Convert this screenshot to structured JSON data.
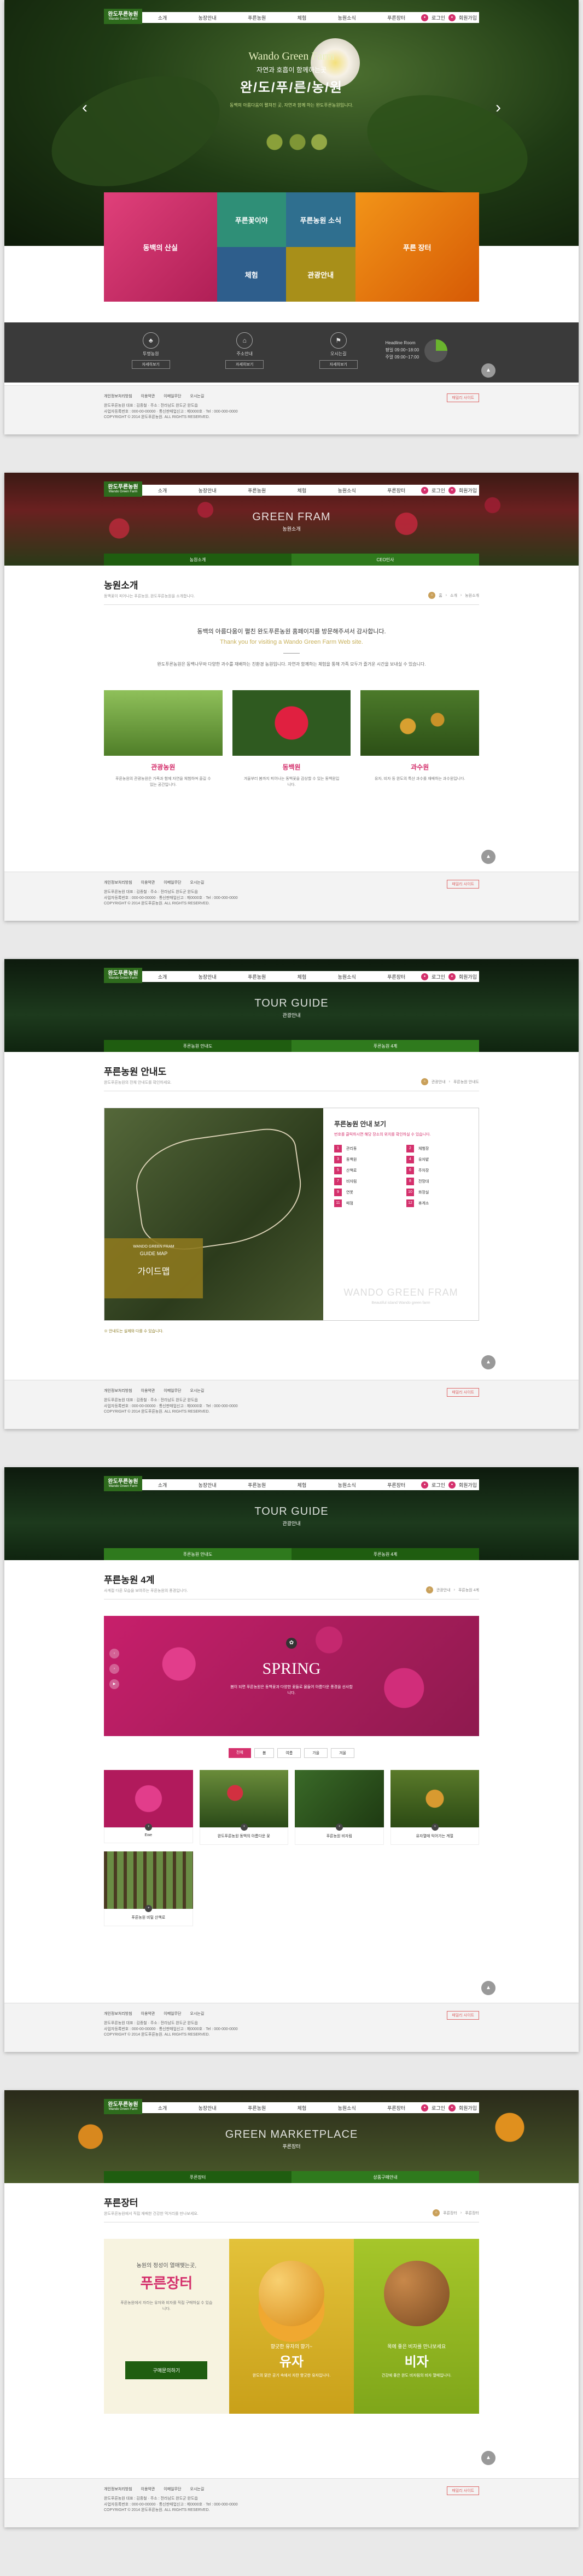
{
  "nav": {
    "logo": "완도푸른농원",
    "logo_sub": "Wando Green Farm",
    "menu": [
      "소개",
      "농장안내",
      "푸른농원",
      "체험",
      "농원소식",
      "푸른장터"
    ],
    "util": [
      "로그인",
      "회원가입"
    ]
  },
  "hero": {
    "en_title": "Wando Green Farm",
    "kr_sub": "자연과 호흡이 함께하는곳",
    "kr_title": "완/도/푸/른/농/원",
    "desc": "동백의 아름다움이 펼쳐진 곳, 자연과 함께 하는 완도푸른농원입니다."
  },
  "tiles": [
    {
      "label": "동백의 산실",
      "color": "#d4306c"
    },
    {
      "label": "푸른꽃이야",
      "sub": "체험",
      "color": "#3a9a80"
    },
    {
      "label": "푸른농원 소식",
      "sub": "관광안내",
      "color": "#b79a1c"
    },
    {
      "label": "푸른 장터",
      "color": "#e87a10"
    }
  ],
  "info": {
    "items": [
      {
        "label": "투명농원",
        "btn": "자세히보기",
        "icon": "tree-icon"
      },
      {
        "label": "주소안내",
        "btn": "자세히보기",
        "icon": "map-icon"
      },
      {
        "label": "오시는길",
        "btn": "자세히보기",
        "icon": "car-icon"
      }
    ],
    "hours_title": "Headline Room",
    "hours_line1": "평일 09:00~18:00",
    "hours_line2": "주말 09:00~17:00"
  },
  "footer": {
    "links": [
      "개인정보처리방침",
      "이용약관",
      "이메일무단",
      "오시는길"
    ],
    "select": "패밀리 사이트",
    "lines": [
      "완도푸른농원 대표 : 김종철 · 주소 : 전라남도 완도군 완도읍",
      "사업자등록번호 : 000-00-00000 · 통신판매업신고 : 제0000호 · Tel : 000-000-0000",
      "COPYRIGHT © 2014 완도푸른농원. ALL RIGHTS RESERVED."
    ]
  },
  "p2": {
    "head_title": "GREEN FRAM",
    "head_sub": "농원소개",
    "subnav": [
      "농원소개",
      "CEO인사"
    ],
    "title": "농원소개",
    "desc": "동백꽃이 피어나는 푸른농원, 완도푸른농원을 소개합니다.",
    "crumb": [
      "홈",
      "소개",
      "농원소개"
    ],
    "greet": "동백의 아름다움이 펼친 완도푸른농원 홈페이지를 방문해주셔서 감사합니다.",
    "greet_en": "Thank you for visiting a Wando Green Farm Web site.",
    "body": "완도푸른농원은 동백나무와 다양한 과수를 재배하는 친환경 농원입니다. 자연과 함께하는 체험을 통해 가족 모두가 즐거운 시간을 보내실 수 있습니다.",
    "cards": [
      {
        "title": "관광농원",
        "text": "푸른농원의 관광농원은 가족과 함께 자연을 체험하며 즐길 수 있는 공간입니다."
      },
      {
        "title": "동백원",
        "text": "겨울부터 봄까지 피어나는 동백꽃을 감상할 수 있는 동백원입니다."
      },
      {
        "title": "과수원",
        "text": "유자, 비자 등 완도의 특산 과수를 재배하는 과수원입니다."
      }
    ]
  },
  "p3": {
    "head_title": "TOUR GUIDE",
    "head_sub": "관광안내",
    "subnav": [
      "푸른농원 안내도",
      "푸른농원 4계"
    ],
    "title": "푸른농원 안내도",
    "desc": "완도푸른농원의 전체 안내도를 확인하세요.",
    "map_label1": "WANDO GREEN FRAM",
    "map_label2": "GUIDE MAP",
    "map_label3": "가이드맵",
    "legend_title": "푸른농원 안내 보기",
    "legend_desc": "번호를 클릭하시면 해당 장소의 위치를 확인하실 수 있습니다.",
    "legend": [
      "관리동",
      "체험장",
      "동백원",
      "유자밭",
      "산책로",
      "주차장",
      "비자림",
      "전망대",
      "연못",
      "화장실",
      "매점",
      "휴게소"
    ],
    "wm1": "WANDO GREEN FRAM",
    "wm2": "Beautiful island Wando green farm",
    "note": "※ 안내도는 실제와 다를 수 있습니다."
  },
  "p4": {
    "title": "푸른농원 4계",
    "desc": "사계절 다른 모습을 보여주는 푸른농원의 풍경입니다.",
    "season": "SPRING",
    "season_desc": "봄이 되면 푸른농원은 동백꽃과 다양한 꽃들로 물들어 아름다운 풍경을 선사합니다.",
    "tabs": [
      "전체",
      "봄",
      "여름",
      "가을",
      "겨울"
    ],
    "gallery": [
      "Ewe",
      "완도푸른농원 동백의 아름다운 꽃",
      "푸른농원 비자림",
      "유자열매 익어가는 계절",
      "푸른농원 비밀 산책로"
    ]
  },
  "p5": {
    "head_title": "GREEN MARKETPLACE",
    "head_sub": "푸른장터",
    "subnav": [
      "푸른장터",
      "상품구매안내"
    ],
    "title": "푸른장터",
    "desc": "완도푸른농원에서 직접 재배한 건강한 먹거리를 만나보세요.",
    "intro_small": "농원의 정성이 열매맺는곳,",
    "intro_big": "푸른장터",
    "intro_text": "푸른농원에서 자라는 유자와 비자를 직접 구매하실 수 있습니다.",
    "buy_btn": "구매문의하기",
    "p1_small": "향긋한 유자의 향기~",
    "p1_big": "유자",
    "p1_text": "완도의 맑은 공기 속에서 자란 향긋한 유자입니다.",
    "p2_small": "목에 좋은 비자를 만나보세요",
    "p2_big": "비자",
    "p2_text": "건강에 좋은 완도 비자림의 비자 열매입니다."
  }
}
